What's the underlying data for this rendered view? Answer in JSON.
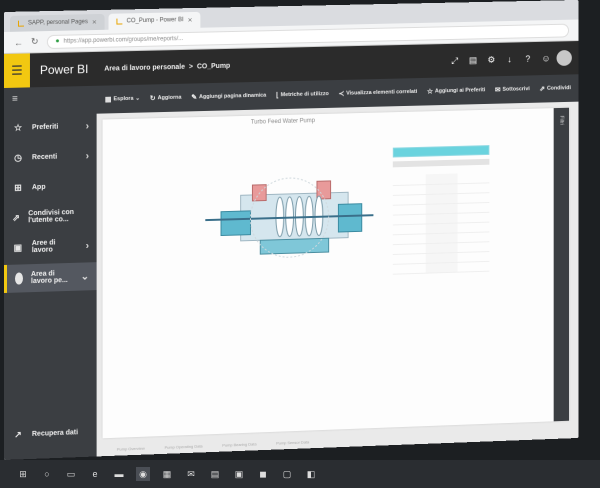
{
  "browser": {
    "tabs": [
      {
        "label": "SAPP, personal Pages"
      },
      {
        "label": "CO_Pump - Power BI"
      }
    ],
    "url": "https://app.powerbi.com/groups/me/reports/..."
  },
  "header": {
    "brand": "Power BI",
    "breadcrumb_workspace": "Area di lavoro personale",
    "breadcrumb_sep": ">",
    "breadcrumb_report": "CO_Pump"
  },
  "sidebar": {
    "items": [
      {
        "label": "Preferiti",
        "icon": "star-icon"
      },
      {
        "label": "Recenti",
        "icon": "clock-icon"
      },
      {
        "label": "App",
        "icon": "apps-icon"
      },
      {
        "label": "Condivisi con l'utente co...",
        "icon": "share-icon"
      },
      {
        "label": "Aree di lavoro",
        "icon": "workspaces-icon"
      },
      {
        "label": "Area di lavoro pe...",
        "icon": "workspace-avatar-icon"
      }
    ],
    "get_data": "Recupera dati"
  },
  "toolbar": {
    "items": [
      {
        "label": "Esplora",
        "icon": "explore-icon"
      },
      {
        "label": "Aggiorna",
        "icon": "refresh-icon"
      },
      {
        "label": "Aggiungi pagina dinamica",
        "icon": "pin-icon"
      },
      {
        "label": "Metriche di utilizzo",
        "icon": "metrics-icon"
      },
      {
        "label": "Visualizza elementi correlati",
        "icon": "related-icon"
      },
      {
        "label": "Aggiungi ai Preferiti",
        "icon": "star-icon"
      },
      {
        "label": "Sottoscrivi",
        "icon": "subscribe-icon"
      },
      {
        "label": "Condividi",
        "icon": "share-icon"
      }
    ]
  },
  "report": {
    "title": "Turbo Feed Water Pump",
    "side_panel": "Filtri",
    "page_tabs": [
      "Pump Overview",
      "Pump Operating Data",
      "Pump Bearing Data",
      "Pump Sensor Data"
    ]
  },
  "colors": {
    "accent": "#f2c811",
    "sidebar": "#3b3e42",
    "cyan": "#6ad3de"
  }
}
